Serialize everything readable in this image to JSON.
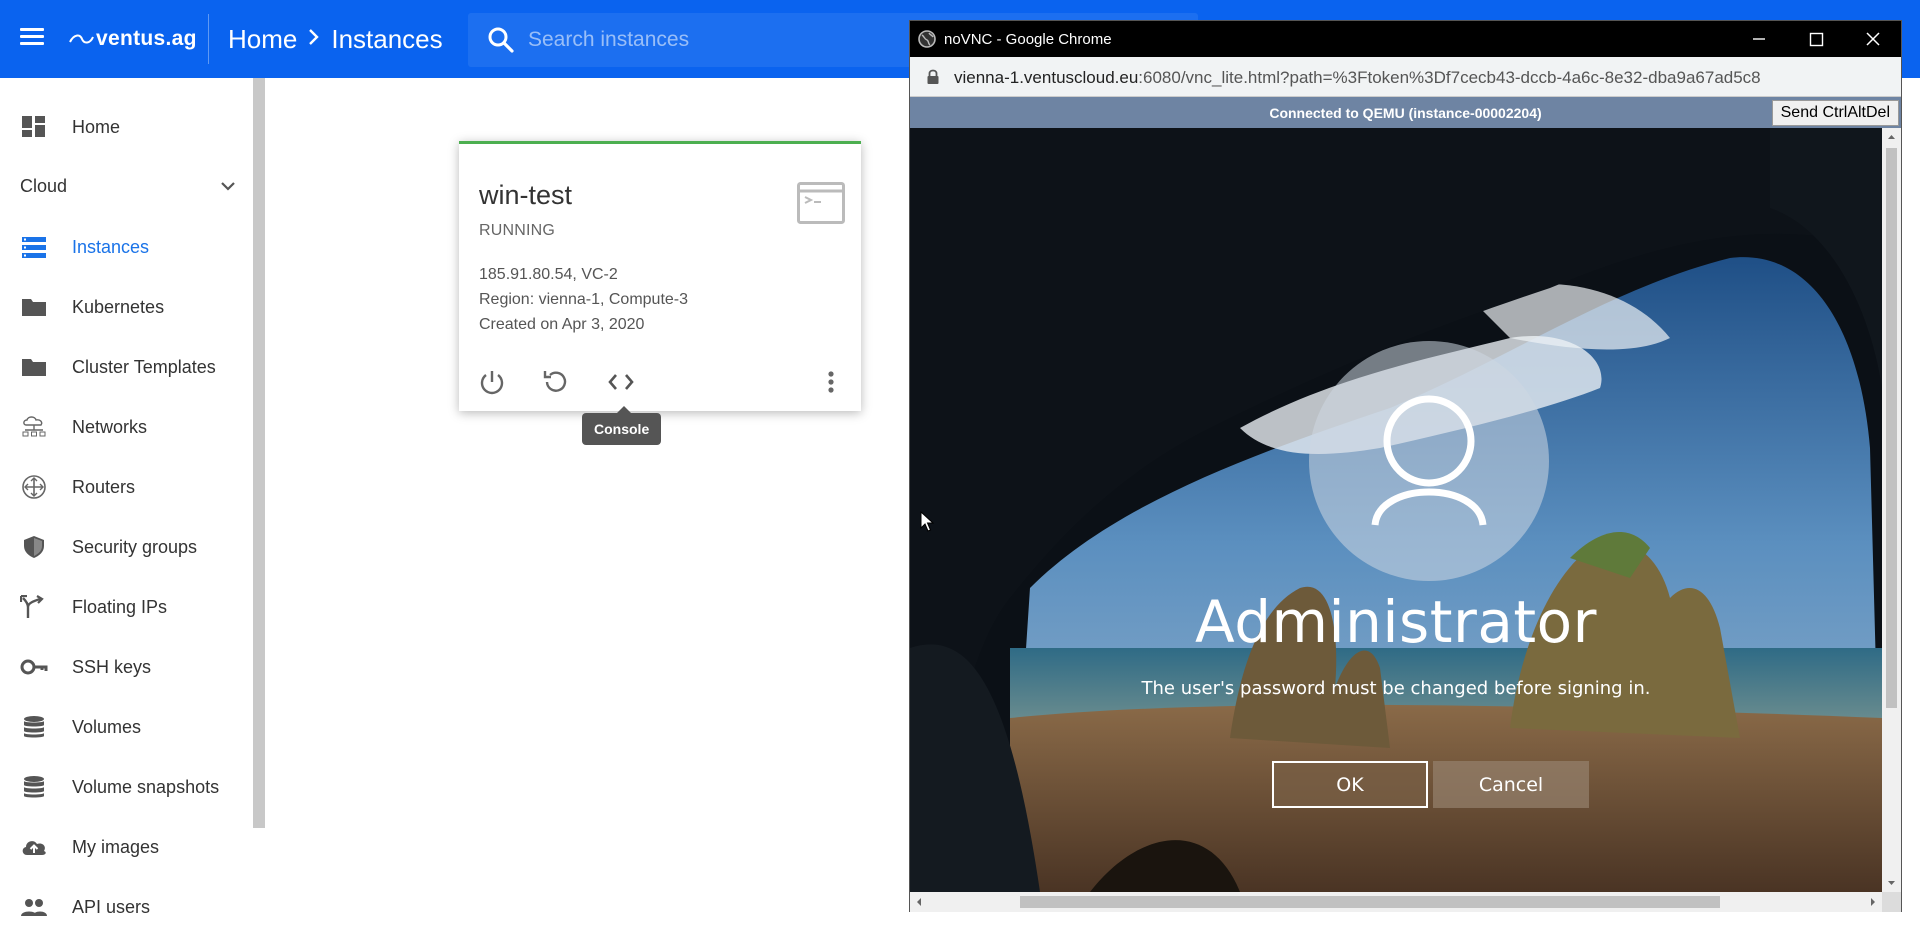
{
  "header": {
    "logo_text": "ventus.ag",
    "breadcrumb": [
      "Home",
      "Instances"
    ],
    "breadcrumb_separator": "›",
    "search_placeholder": "Search instances",
    "bg_color": "#0a63ef"
  },
  "sidebar": {
    "items": [
      {
        "label": "Home",
        "icon": "dashboard-icon"
      },
      {
        "label": "Instances",
        "icon": "instances-icon",
        "active": true
      },
      {
        "label": "Kubernetes",
        "icon": "folder-icon"
      },
      {
        "label": "Cluster Templates",
        "icon": "folder-icon"
      },
      {
        "label": "Networks",
        "icon": "network-icon"
      },
      {
        "label": "Routers",
        "icon": "router-icon"
      },
      {
        "label": "Security groups",
        "icon": "shield-icon"
      },
      {
        "label": "Floating IPs",
        "icon": "fork-icon"
      },
      {
        "label": "SSH keys",
        "icon": "key-icon"
      },
      {
        "label": "Volumes",
        "icon": "database-icon"
      },
      {
        "label": "Volume snapshots",
        "icon": "database-icon"
      },
      {
        "label": "My images",
        "icon": "cloud-upload-icon"
      },
      {
        "label": "API users",
        "icon": "people-icon"
      }
    ],
    "section_label": "Cloud",
    "active_color": "#1a73e8"
  },
  "instance_card": {
    "name": "win-test",
    "status": "RUNNING",
    "address_line": "185.91.80.54, VC-2",
    "region_line": "Region: vienna-1, Compute-3",
    "created_line": "Created on Apr 3, 2020",
    "status_color": "#4caf50",
    "tooltip": "Console"
  },
  "popup": {
    "window_title": "noVNC - Google Chrome",
    "url_host": "vienna-1.ventuscloud.eu",
    "url_rest": ":6080/vnc_lite.html?path=%3Ftoken%3Df7cecb43-dccb-4a6c-8e32-dba9a67ad5c8",
    "vnc_status": "Connected to QEMU (instance-00002204)",
    "send_ctrl_alt_del": "Send CtrlAltDel",
    "lock_screen": {
      "username": "Administrator",
      "message": "The user's password must be changed before signing in.",
      "ok_label": "OK",
      "cancel_label": "Cancel"
    }
  }
}
